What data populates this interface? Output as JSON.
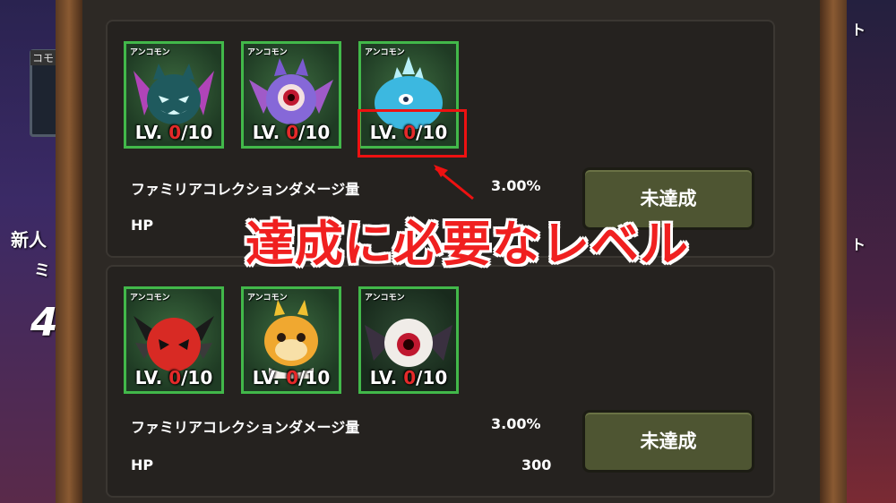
{
  "side": {
    "icon_tag": "コモ",
    "label_new": "新人",
    "label_mi": "ミ",
    "big_num": "4",
    "right_top": "ト",
    "right_mid": "ト"
  },
  "collections": [
    {
      "monsters": [
        {
          "rarity": "アンコモン",
          "lv_prefix": "LV. ",
          "lv_current": "0",
          "lv_max": "/10",
          "icon": "purple-bat-ghost"
        },
        {
          "rarity": "アンコモン",
          "lv_prefix": "LV. ",
          "lv_current": "0",
          "lv_max": "/10",
          "icon": "purple-eye-bat"
        },
        {
          "rarity": "アンコモン",
          "lv_prefix": "LV. ",
          "lv_current": "0",
          "lv_max": "/10",
          "icon": "blue-spiky-slime"
        }
      ],
      "stat1_label": "ファミリアコレクションダメージ量",
      "stat1_value": "3.00%",
      "stat2_label": "HP",
      "stat2_value": "",
      "button_label": "未達成"
    },
    {
      "monsters": [
        {
          "rarity": "アンコモン",
          "lv_prefix": "LV. ",
          "lv_current": "0",
          "lv_max": "/10",
          "icon": "red-horned-devil"
        },
        {
          "rarity": "アンコモン",
          "lv_prefix": "LV. ",
          "lv_current": "0",
          "lv_max": "/10",
          "icon": "orange-dragon"
        },
        {
          "rarity": "アンコモン",
          "lv_prefix": "LV. ",
          "lv_current": "0",
          "lv_max": "/10",
          "icon": "flying-eyeball"
        }
      ],
      "stat1_label": "ファミリアコレクションダメージ量",
      "stat1_value": "3.00%",
      "stat2_label": "HP",
      "stat2_value": "300",
      "button_label": "未達成"
    }
  ],
  "annotation": {
    "text": "達成に必要なレベル",
    "color": "#f02020"
  }
}
